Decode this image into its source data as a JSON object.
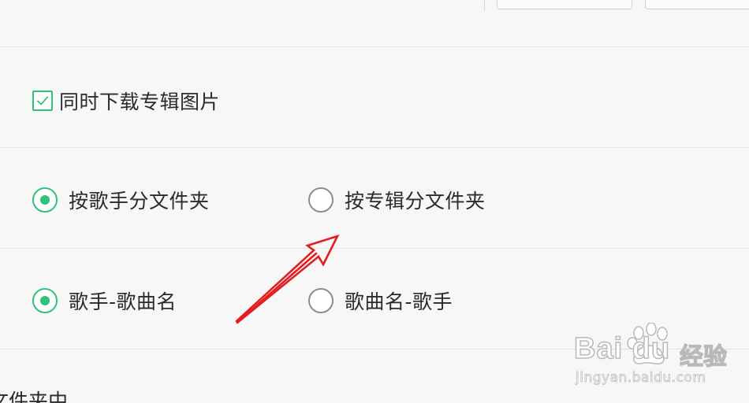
{
  "options": {
    "download_album_image": {
      "label": "同时下载专辑图片",
      "checked": true
    },
    "folder_by_singer": {
      "label": "按歌手分文件夹",
      "selected": true
    },
    "folder_by_album": {
      "label": "按专辑分文件夹",
      "selected": false
    },
    "naming_singer_song": {
      "label": "歌手-歌曲名",
      "selected": true
    },
    "naming_song_singer": {
      "label": "歌曲名-歌手",
      "selected": false
    }
  },
  "bottom_text": "文件夹中",
  "watermark": {
    "logo": "Bai du",
    "cn": "经验",
    "url": "jingyan.baidu.com"
  },
  "colors": {
    "accent": "#31c27c",
    "annotation_arrow": "#e02020",
    "background": "#f7f7f7"
  },
  "icons": {
    "checkbox": "check-icon",
    "annotation": "red-arrow-annotation",
    "watermark": "baidu-paw-logo"
  }
}
